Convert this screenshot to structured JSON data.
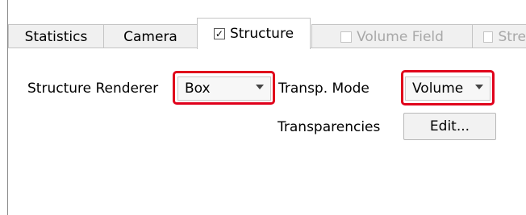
{
  "tabs": [
    {
      "label": "Statistics",
      "checkbox": false,
      "enabled": true,
      "active": false
    },
    {
      "label": "Camera",
      "checkbox": false,
      "enabled": true,
      "active": false
    },
    {
      "label": "Structure",
      "checkbox": true,
      "checked": true,
      "enabled": true,
      "active": true
    },
    {
      "label": "Volume Field",
      "checkbox": true,
      "checked": false,
      "enabled": false,
      "active": false
    },
    {
      "label": "Stre",
      "checkbox": true,
      "checked": false,
      "enabled": false,
      "active": false
    }
  ],
  "structure_renderer": {
    "label": "Structure Renderer",
    "value": "Box"
  },
  "transp_mode": {
    "label": "Transp. Mode",
    "value": "Volume"
  },
  "transparencies": {
    "label": "Transparencies",
    "button": "Edit..."
  },
  "check_glyph": "✓",
  "colors": {
    "highlight": "#e0001b",
    "disabled_text": "#a8a8a8"
  }
}
